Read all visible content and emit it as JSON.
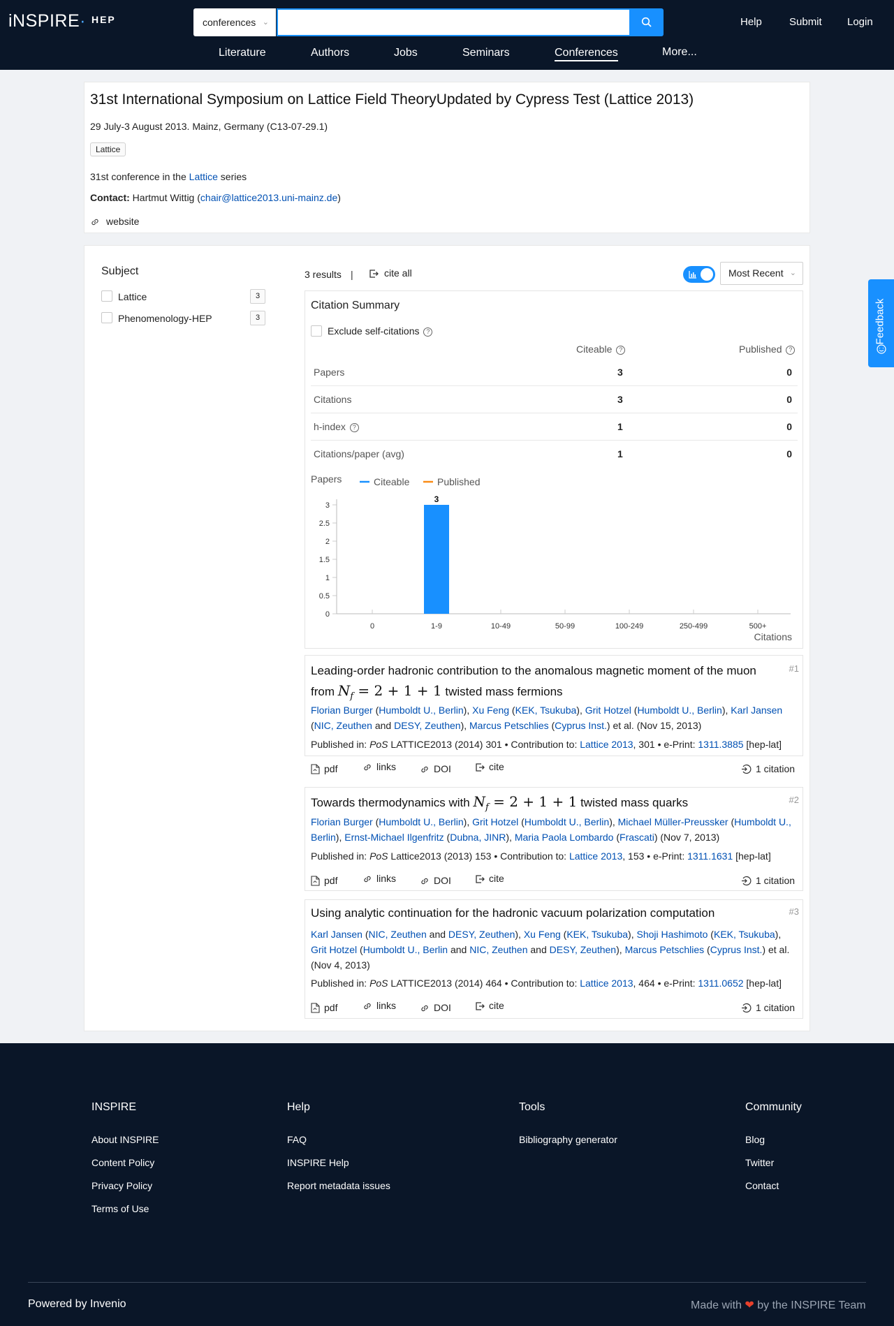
{
  "header": {
    "logo_main": "iNSPIRE",
    "logo_hep": "HEP",
    "search_scope": "conferences",
    "search_placeholder": "",
    "links": [
      "Help",
      "Submit",
      "Login"
    ]
  },
  "nav": [
    "Literature",
    "Authors",
    "Jobs",
    "Seminars",
    "Conferences",
    "More..."
  ],
  "nav_active": "Conferences",
  "conference": {
    "title": "31st International Symposium on Lattice Field TheoryUpdated by Cypress Test (Lattice 2013)",
    "dates_location": "29 July-3 August 2013. Mainz, Germany (C13-07-29.1)",
    "tag": "Lattice",
    "series_prefix": "31st conference in the ",
    "series_link": "Lattice",
    "series_suffix": " series",
    "contact_label": "Contact:",
    "contact_name": "Hartmut Wittig",
    "contact_email": "chair@lattice2013.uni-mainz.de",
    "website_label": "website"
  },
  "facets": {
    "title": "Subject",
    "items": [
      {
        "label": "Lattice",
        "count": "3"
      },
      {
        "label": "Phenomenology-HEP",
        "count": "3"
      }
    ]
  },
  "results_bar": {
    "count": "3 results",
    "separator": "|",
    "cite_all": "cite all",
    "sort": "Most Recent"
  },
  "citation_summary": {
    "title": "Citation Summary",
    "exclude_label": "Exclude self-citations",
    "col_citeable": "Citeable",
    "col_published": "Published",
    "rows": [
      {
        "label": "Papers",
        "citeable": "3",
        "published": "0"
      },
      {
        "label": "Citations",
        "citeable": "3",
        "published": "0"
      },
      {
        "label": "h-index",
        "citeable": "1",
        "published": "0"
      },
      {
        "label": "Citations/paper (avg)",
        "citeable": "1",
        "published": "0"
      }
    ]
  },
  "chart_data": {
    "type": "bar",
    "ylabel": "Papers",
    "xlabel": "Citations",
    "categories": [
      "0",
      "1-9",
      "10-49",
      "50-99",
      "100-249",
      "250-499",
      "500+"
    ],
    "series": [
      {
        "name": "Citeable",
        "values": [
          0,
          3,
          0,
          0,
          0,
          0,
          0
        ],
        "color": "#1890ff"
      },
      {
        "name": "Published",
        "values": [
          0,
          0,
          0,
          0,
          0,
          0,
          0
        ],
        "color": "#fa8c16"
      }
    ],
    "yticks": [
      "0",
      "0.5",
      "1",
      "1.5",
      "2",
      "2.5",
      "3"
    ],
    "ylim": [
      0,
      3
    ],
    "data_labels": [
      "3"
    ]
  },
  "results": [
    {
      "num": "#1",
      "title_pre": "Leading-order hadronic contribution to the anomalous magnetic moment of the muon from",
      "title_post": "twisted mass fermions",
      "authors": [
        {
          "name": "Florian Burger",
          "affs": [
            "Humboldt U., Berlin"
          ]
        },
        {
          "name": "Xu Feng",
          "affs": [
            "KEK, Tsukuba"
          ]
        },
        {
          "name": "Grit Hotzel",
          "affs": [
            "Humboldt U., Berlin"
          ]
        },
        {
          "name": "Karl Jansen",
          "affs": [
            "NIC, Zeuthen",
            "DESY, Zeuthen"
          ]
        },
        {
          "name": "Marcus Petschlies",
          "affs": [
            "Cyprus Inst."
          ]
        }
      ],
      "etal": "et al.",
      "date": "(Nov 15, 2013)",
      "pub_journal": "PoS",
      "pub_rest": "LATTICE2013 (2014) 301",
      "contrib_link": "Lattice 2013",
      "contrib_rest": ", 301",
      "eprint": "1311.3885",
      "arxiv_cat": "[hep-lat]",
      "citations": "1 citation"
    },
    {
      "num": "#2",
      "title_pre": "Towards thermodynamics with",
      "title_post": "twisted mass quarks",
      "authors": [
        {
          "name": "Florian Burger",
          "affs": [
            "Humboldt U., Berlin"
          ]
        },
        {
          "name": "Grit Hotzel",
          "affs": [
            "Humboldt U., Berlin"
          ]
        },
        {
          "name": "Michael Müller-Preussker",
          "affs": [
            "Humboldt U., Berlin"
          ]
        },
        {
          "name": "Ernst-Michael Ilgenfritz",
          "affs": [
            "Dubna, JINR"
          ]
        },
        {
          "name": "Maria Paola Lombardo",
          "affs": [
            "Frascati"
          ]
        }
      ],
      "etal": "",
      "date": "(Nov 7, 2013)",
      "pub_journal": "PoS",
      "pub_rest": "Lattice2013 (2013) 153",
      "contrib_link": "Lattice 2013",
      "contrib_rest": ", 153",
      "eprint": "1311.1631",
      "arxiv_cat": "[hep-lat]",
      "citations": "1 citation"
    },
    {
      "num": "#3",
      "title_pre": "Using analytic continuation for the hadronic vacuum polarization computation",
      "title_post": "",
      "authors": [
        {
          "name": "Karl Jansen",
          "affs": [
            "NIC, Zeuthen",
            "DESY, Zeuthen"
          ]
        },
        {
          "name": "Xu Feng",
          "affs": [
            "KEK, Tsukuba"
          ]
        },
        {
          "name": "Shoji Hashimoto",
          "affs": [
            "KEK, Tsukuba"
          ]
        },
        {
          "name": "Grit Hotzel",
          "affs": [
            "Humboldt U., Berlin",
            "NIC, Zeuthen",
            "DESY, Zeuthen"
          ]
        },
        {
          "name": "Marcus Petschlies",
          "affs": [
            "Cyprus Inst."
          ]
        }
      ],
      "etal": "et al.",
      "date": "(Nov 4, 2013)",
      "pub_journal": "PoS",
      "pub_rest": "LATTICE2013 (2014) 464",
      "contrib_link": "Lattice 2013",
      "contrib_rest": ", 464",
      "eprint": "1311.0652",
      "arxiv_cat": "[hep-lat]",
      "citations": "1 citation"
    }
  ],
  "labels": {
    "published_in": "Published in:",
    "contribution_to": "Contribution to:",
    "eprint": "e-Print:",
    "and": "and",
    "pdf": "pdf",
    "links": "links",
    "doi": "DOI",
    "cite": "cite",
    "bullet": "•"
  },
  "formula": {
    "lhs": "N",
    "sub": "f",
    "rhs": "= 2 + 1 + 1"
  },
  "footer": {
    "columns": [
      {
        "title": "INSPIRE",
        "links": [
          "About INSPIRE",
          "Content Policy",
          "Privacy Policy",
          "Terms of Use"
        ]
      },
      {
        "title": "Help",
        "links": [
          "FAQ",
          "INSPIRE Help",
          "Report metadata issues"
        ]
      },
      {
        "title": "Tools",
        "links": [
          "Bibliography generator"
        ]
      },
      {
        "title": "Community",
        "links": [
          "Blog",
          "Twitter",
          "Contact"
        ]
      }
    ],
    "powered": "Powered by Invenio",
    "made_pre": "Made with",
    "made_post": "by the INSPIRE Team"
  },
  "feedback_label": "Feedback",
  "colors": {
    "brand_dark": "#0a1628",
    "accent": "#1890ff",
    "link": "#0050b3",
    "heart": "#e8402b"
  }
}
